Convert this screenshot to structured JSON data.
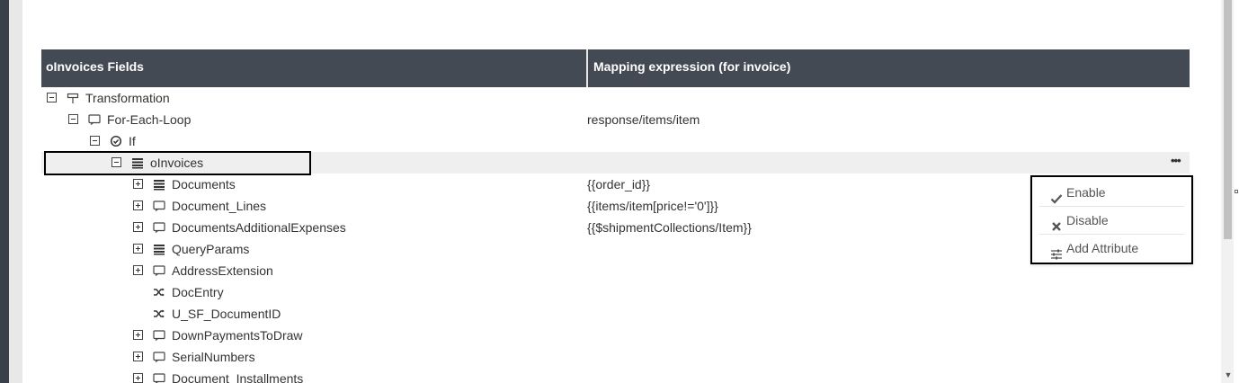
{
  "table": {
    "col_fields": "oInvoices Fields",
    "col_mapping": "Mapping expression (for invoice)"
  },
  "rows": [
    {
      "label": "Transformation",
      "mapping": "",
      "toggle": "minus",
      "icon": "signpost-icon"
    },
    {
      "label": "For-Each-Loop",
      "mapping": "response/items/item",
      "toggle": "minus",
      "icon": "loop-icon"
    },
    {
      "label": "If",
      "mapping": "",
      "toggle": "minus",
      "icon": "check-circle-icon"
    },
    {
      "label": "oInvoices",
      "mapping": "",
      "toggle": "minus",
      "icon": "list-icon",
      "selected": true
    },
    {
      "label": "Documents",
      "mapping": "{{order_id}}",
      "toggle": "plus",
      "icon": "list-icon"
    },
    {
      "label": "Document_Lines",
      "mapping": "{{items/item[price!='0']}}",
      "toggle": "plus",
      "icon": "loop-icon"
    },
    {
      "label": "DocumentsAdditionalExpenses",
      "mapping": "{{$shipmentCollections/Item}}",
      "toggle": "plus",
      "icon": "loop-icon"
    },
    {
      "label": "QueryParams",
      "mapping": "",
      "toggle": "plus",
      "icon": "list-icon"
    },
    {
      "label": "AddressExtension",
      "mapping": "",
      "toggle": "plus",
      "icon": "loop-icon"
    },
    {
      "label": "DocEntry",
      "mapping": "",
      "toggle": "none",
      "icon": "shuffle-icon"
    },
    {
      "label": "U_SF_DocumentID",
      "mapping": "",
      "toggle": "none",
      "icon": "shuffle-icon"
    },
    {
      "label": "DownPaymentsToDraw",
      "mapping": "",
      "toggle": "plus",
      "icon": "loop-icon"
    },
    {
      "label": "SerialNumbers",
      "mapping": "",
      "toggle": "plus",
      "icon": "loop-icon"
    },
    {
      "label": "Document_Installments",
      "mapping": "",
      "toggle": "plus",
      "icon": "loop-icon"
    }
  ],
  "row_menu": {
    "more": "•••",
    "items": [
      {
        "label": "Enable",
        "icon": "check-icon"
      },
      {
        "label": "Disable",
        "icon": "x-icon"
      },
      {
        "label": "Add Attribute",
        "icon": "sliders-icon"
      }
    ]
  },
  "scrollbar": {
    "down_arrow": "▼"
  }
}
